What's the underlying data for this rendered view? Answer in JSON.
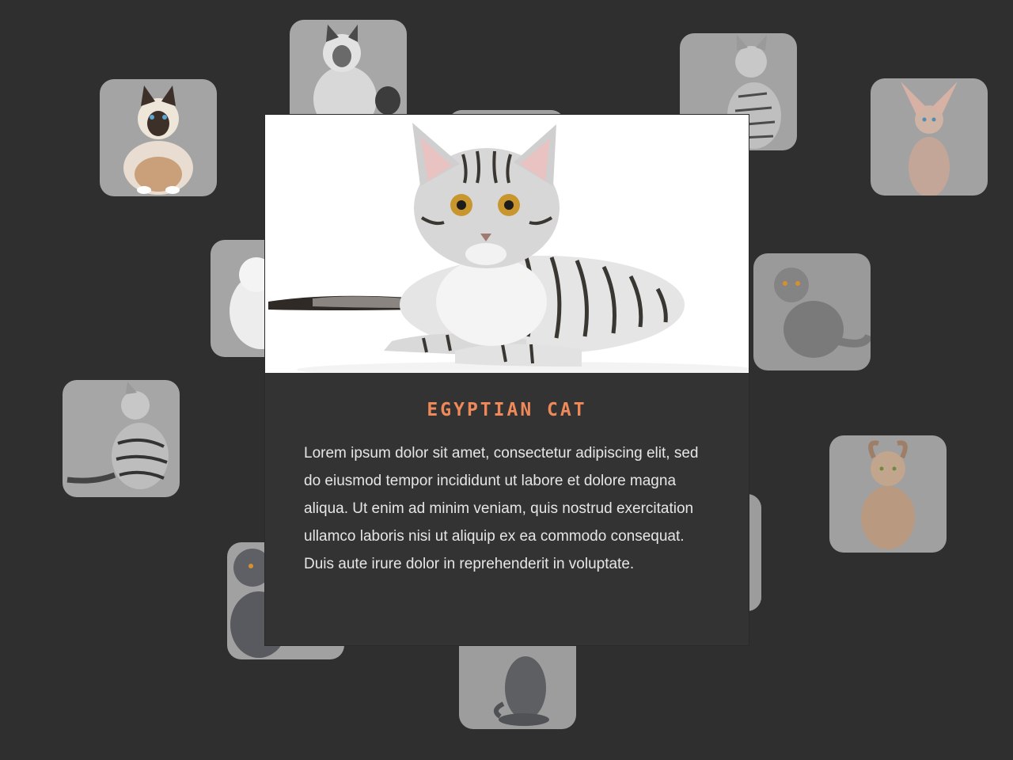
{
  "gallery": {
    "tiles": [
      {
        "breed": "birman-cat"
      },
      {
        "breed": "ragdoll-cat"
      },
      {
        "breed": "hidden-cat"
      },
      {
        "breed": "egyptian-mau-cat"
      },
      {
        "breed": "peterbald-cat"
      },
      {
        "breed": "persian-kitten"
      },
      {
        "breed": "scottish-fold-cat"
      },
      {
        "breed": "american-shorthair-cat"
      },
      {
        "breed": "american-curl-cat"
      },
      {
        "breed": "hidden-cat"
      },
      {
        "breed": "british-shorthair-cat"
      },
      {
        "breed": "russian-blue-cat"
      }
    ]
  },
  "modal": {
    "title": "Egyptian Cat",
    "description": "Lorem ipsum dolor sit amet, consectetur adipiscing elit, sed do eiusmod tempor incididunt ut labore et dolore magna aliqua. Ut enim ad minim veniam, quis nostrud exercitation ullamco laboris nisi ut aliquip ex ea commodo consequat. Duis aute irure dolor in reprehenderit in voluptate.",
    "image": "egyptian-cat-photo"
  },
  "colors": {
    "background": "#2f2f2f",
    "modal": "#333333",
    "title_accent": "#f0895a",
    "body_text": "#e6e6e6"
  }
}
